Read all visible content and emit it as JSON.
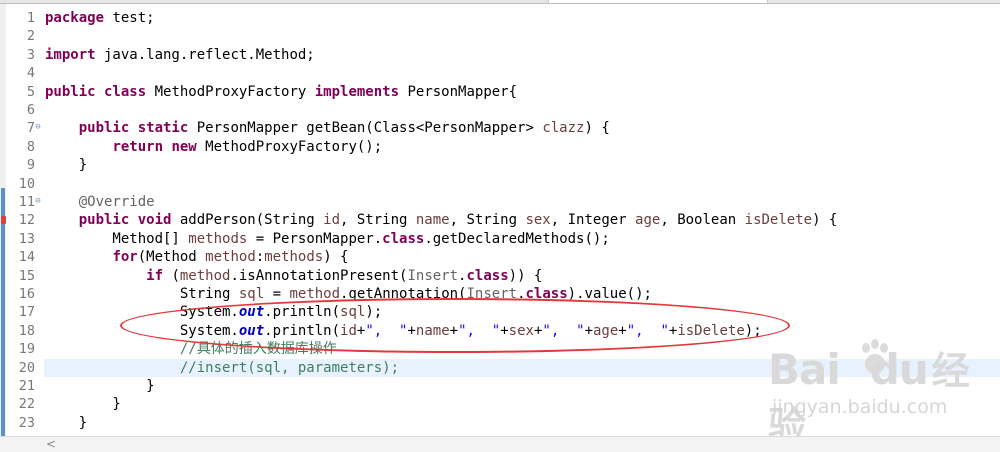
{
  "editor": {
    "lines": [
      {
        "n": "1",
        "code": "<span class=\"kw\">package</span> test;"
      },
      {
        "n": "2",
        "code": ""
      },
      {
        "n": "3",
        "code": "<span class=\"kw\">import</span> java.lang.reflect.Method;"
      },
      {
        "n": "4",
        "code": ""
      },
      {
        "n": "5",
        "code": "<span class=\"kw\">public class</span> MethodProxyFactory <span class=\"kw\">implements</span> PersonMapper{"
      },
      {
        "n": "6",
        "code": ""
      },
      {
        "n": "7",
        "fold": true,
        "code": "    <span class=\"kw\">public static</span> PersonMapper getBean(Class&lt;PersonMapper&gt; <span class=\"var\">clazz</span>) {"
      },
      {
        "n": "8",
        "code": "        <span class=\"kw\">return new</span> MethodProxyFactory();"
      },
      {
        "n": "9",
        "code": "    }"
      },
      {
        "n": "10",
        "code": ""
      },
      {
        "n": "11",
        "fold": true,
        "code": "    <span class=\"ann\">@Override</span>"
      },
      {
        "n": "12",
        "marker": true,
        "code": "    <span class=\"kw\">public void</span> addPerson(String <span class=\"var\">id</span>, String <span class=\"var\">name</span>, String <span class=\"var\">sex</span>, Integer <span class=\"var\">age</span>, Boolean <span class=\"var\">isDelete</span>) {"
      },
      {
        "n": "13",
        "code": "        Method[] <span class=\"var\">methods</span> = PersonMapper.<span class=\"kw\">class</span>.getDeclaredMethods();"
      },
      {
        "n": "14",
        "code": "        <span class=\"kw\">for</span>(Method <span class=\"var\">method</span>:<span class=\"var\">methods</span>) {"
      },
      {
        "n": "15",
        "code": "            <span class=\"kw\">if</span> (<span class=\"var\">method</span>.isAnnotationPresent(<span class=\"ann\">Insert</span>.<span class=\"kw\">class</span>)) {"
      },
      {
        "n": "16",
        "code": "                String <span class=\"var\">sql</span> = <span class=\"var\">method</span>.getAnnotation(<span class=\"ann\">Insert</span>.<span class=\"kw\">class</span>).value();"
      },
      {
        "n": "17",
        "code": "                System.<span class=\"fld\">out</span>.println(<span class=\"var\">sql</span>);"
      },
      {
        "n": "18",
        "code": "                System.<span class=\"fld\">out</span>.println(<span class=\"var\">id</span>+<span class=\"str\">\",  \"</span>+<span class=\"var\">name</span>+<span class=\"str\">\",  \"</span>+<span class=\"var\">sex</span>+<span class=\"str\">\",  \"</span>+<span class=\"var\">age</span>+<span class=\"str\">\",  \"</span>+<span class=\"var\">isDelete</span>);"
      },
      {
        "n": "19",
        "code": "                <span class=\"com\">//具体的插入数据库操作</span>"
      },
      {
        "n": "20",
        "current": true,
        "code": "                <span class=\"com\">//insert(sql, parameters);</span>"
      },
      {
        "n": "21",
        "code": "            }"
      },
      {
        "n": "22",
        "code": "        }"
      },
      {
        "n": "23",
        "code": "    }"
      }
    ]
  },
  "watermark": {
    "logo_text": "Bai",
    "logo_text2": "du",
    "logo_cn": "经验",
    "url": "jingyan.baidu.com"
  },
  "colors": {
    "keyword": "#7f0055",
    "annotation": "#646464",
    "comment": "#3f7f5f",
    "string": "#2a00ff",
    "static_field": "#0000c0",
    "highlight_ellipse": "#e23a3a"
  },
  "icons": {
    "fold": "collapse-icon",
    "marker": "override-marker-icon",
    "scroll_left": "scroll-left-arrow-icon"
  }
}
